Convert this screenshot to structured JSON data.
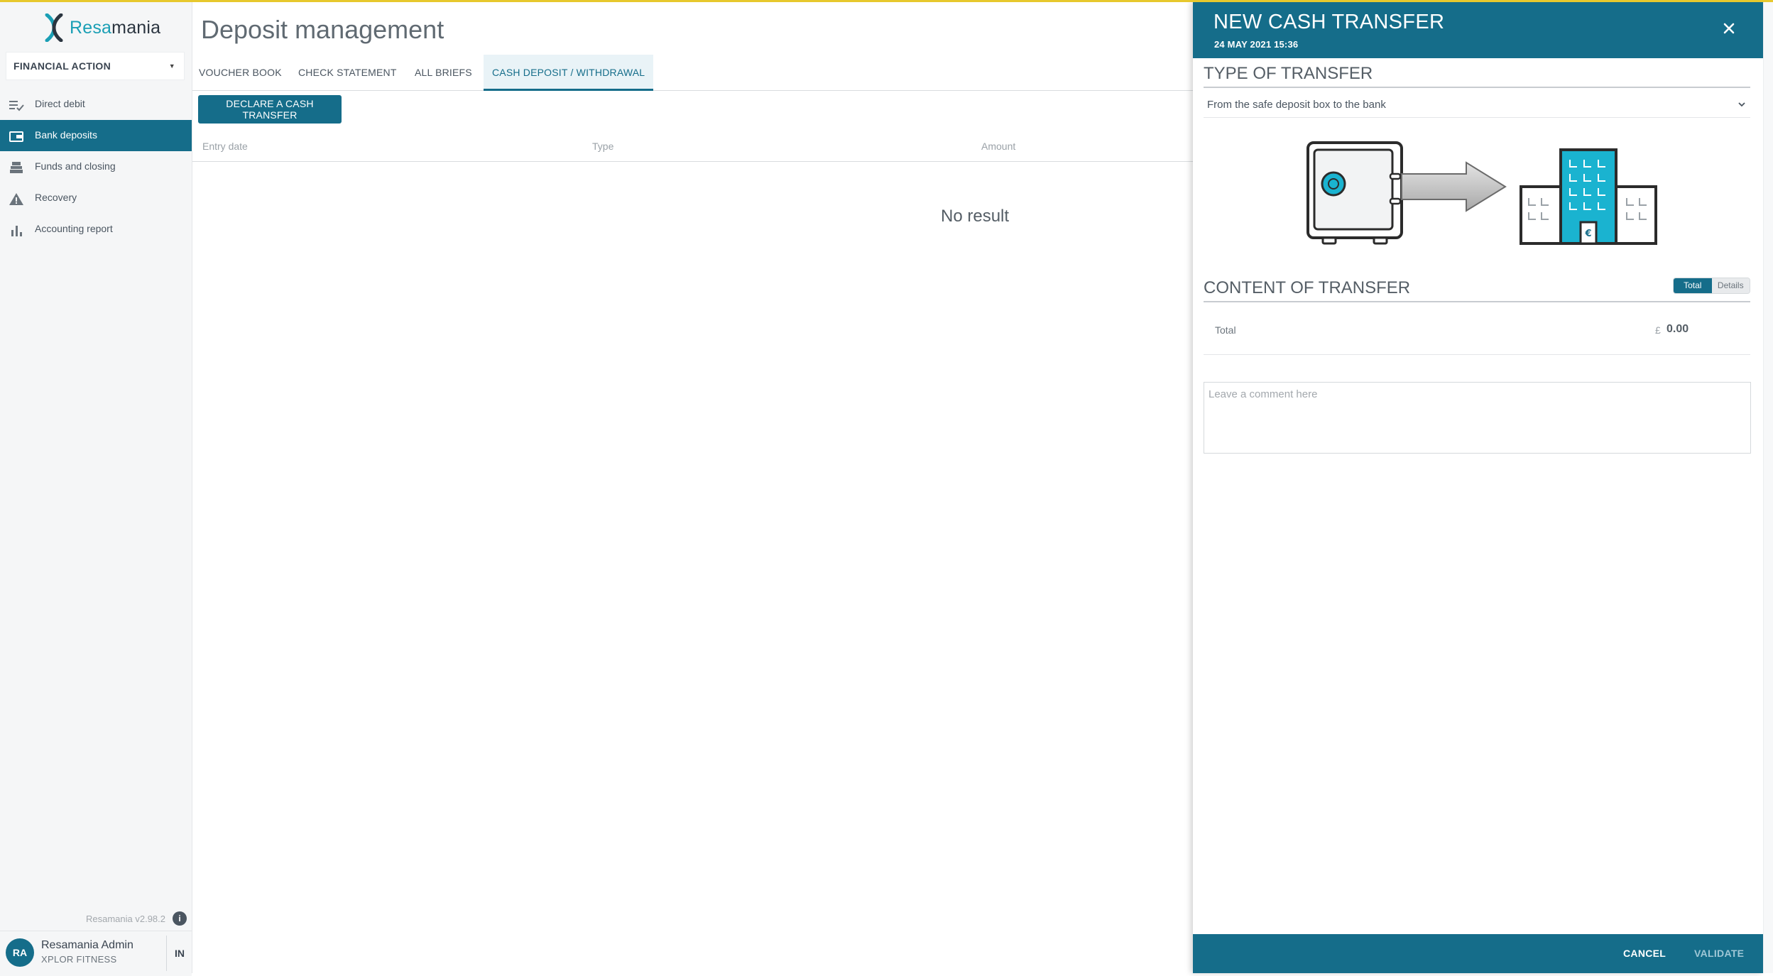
{
  "app": {
    "logo_part1": "Resa",
    "logo_part2": "mania",
    "context_select": "FINANCIAL ACTION",
    "version": "Resamania v2.98.2"
  },
  "sidebar": {
    "items": [
      {
        "label": "Direct debit",
        "icon": "list-check-icon"
      },
      {
        "label": "Bank deposits",
        "icon": "wallet-icon",
        "active": true
      },
      {
        "label": "Funds and closing",
        "icon": "cash-register-icon"
      },
      {
        "label": "Recovery",
        "icon": "warning-icon"
      },
      {
        "label": "Accounting report",
        "icon": "bar-chart-icon"
      }
    ]
  },
  "user": {
    "initials": "RA",
    "name": "Resamania Admin",
    "company": "XPLOR FITNESS",
    "action": "IN"
  },
  "main": {
    "title": "Deposit management",
    "tabs": [
      {
        "label": "VOUCHER BOOK"
      },
      {
        "label": "CHECK STATEMENT"
      },
      {
        "label": "ALL BRIEFS"
      },
      {
        "label": "CASH DEPOSIT / WITHDRAWAL",
        "active": true
      }
    ],
    "declare_button": "DECLARE A CASH TRANSFER",
    "columns": [
      "Entry date",
      "Type",
      "Amount"
    ],
    "empty_text": "No result"
  },
  "panel": {
    "title": "NEW CASH TRANSFER",
    "date": "24 MAY 2021 15:36",
    "type_section": "TYPE OF TRANSFER",
    "type_value": "From the safe deposit box to the bank",
    "content_section": "CONTENT OF TRANSFER",
    "toggle_total": "Total",
    "toggle_details": "Details",
    "total_label": "Total",
    "currency": "£",
    "total_value": "0.00",
    "comment_placeholder": "Leave a comment here",
    "cancel": "CANCEL",
    "validate": "VALIDATE"
  },
  "colors": {
    "primary": "#156d8a",
    "accent": "#1a9fb5",
    "top_line": "#e7c82d",
    "building": "#1ab3d0"
  }
}
